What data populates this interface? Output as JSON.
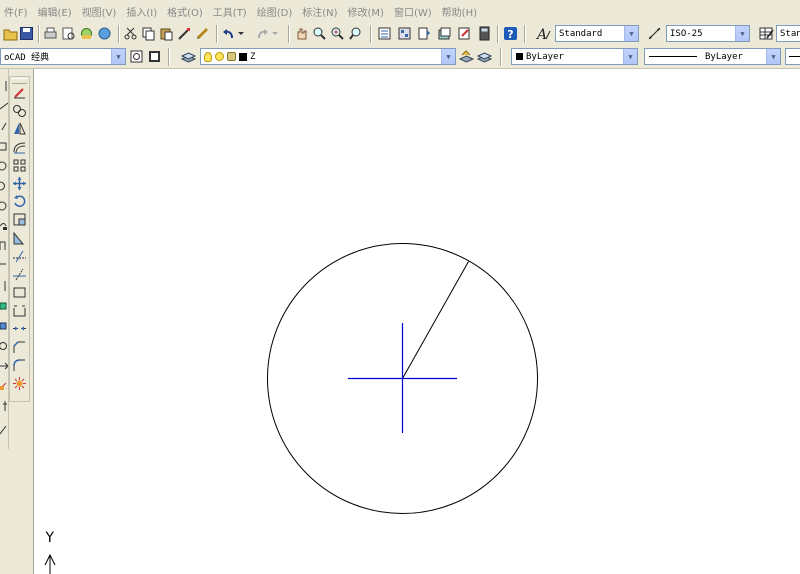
{
  "menubar": {
    "items": [
      "件(F)",
      "编辑(E)",
      "视图(V)",
      "插入(I)",
      "格式(O)",
      "工具(T)",
      "绘图(D)",
      "标注(N)",
      "修改(M)",
      "窗口(W)",
      "帮助(H)"
    ]
  },
  "standard_toolbar": {
    "text_style_value": "Standard",
    "dim_style_value": "ISO-25",
    "table_style_value": "Stan"
  },
  "workspace_toolbar": {
    "workspace_value": "oCAD 经典"
  },
  "layers_toolbar": {
    "layer_value": "Z"
  },
  "properties_toolbar": {
    "color_value": "ByLayer",
    "linetype_value": "ByLayer"
  },
  "ucs_icon": {
    "y_label": "Y"
  },
  "colors": {
    "accent_blue": "#0000cc",
    "canvas_bg": "#ffffff",
    "toolbar_bg": "#ece9d8"
  }
}
